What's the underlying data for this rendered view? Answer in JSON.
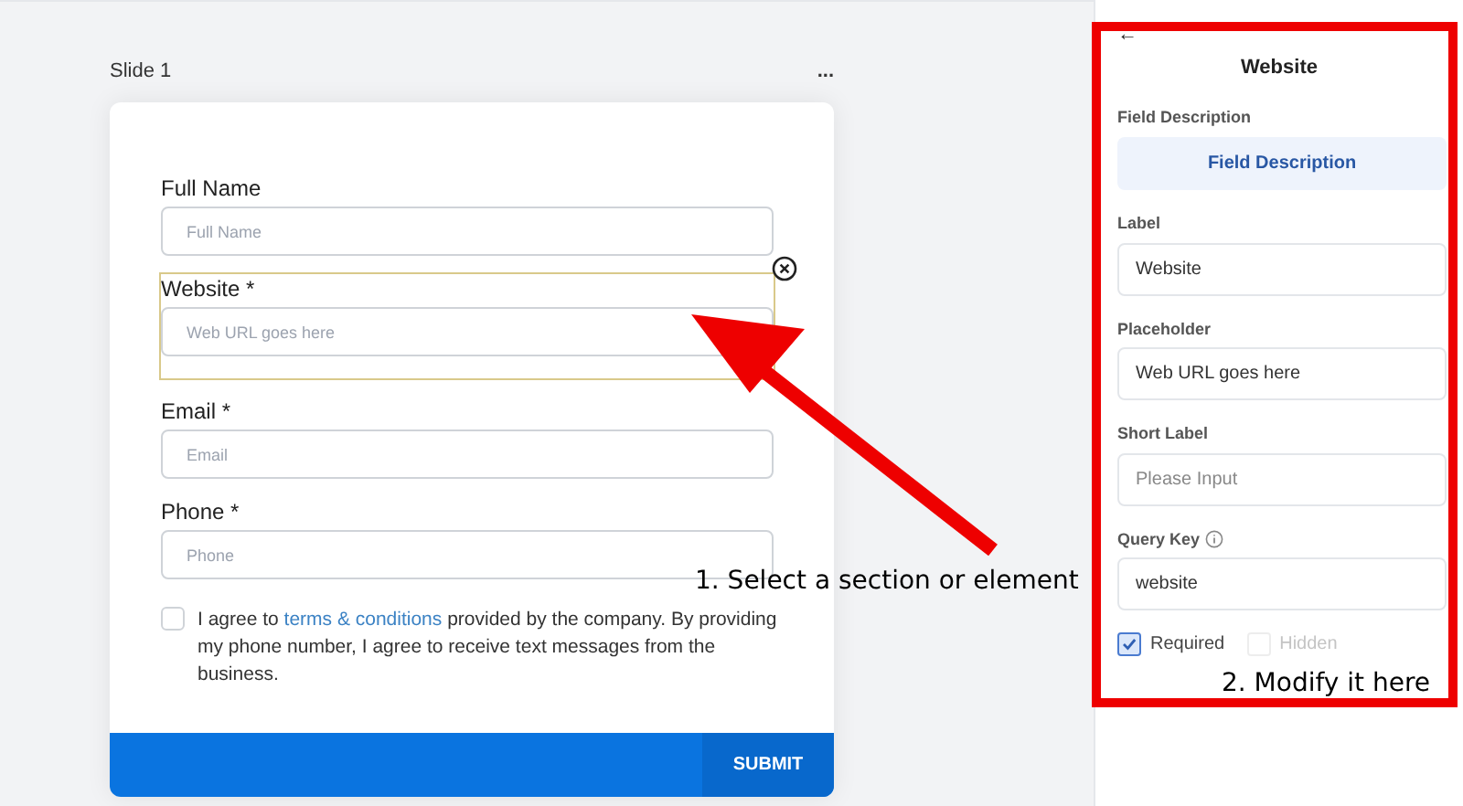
{
  "slide": {
    "title": "Slide 1",
    "menu": "..."
  },
  "form": {
    "fields": [
      {
        "label": "Full Name",
        "placeholder": "Full Name",
        "selected": false
      },
      {
        "label": "Website *",
        "placeholder": "Web URL goes here",
        "selected": true
      },
      {
        "label": "Email *",
        "placeholder": "Email",
        "selected": false
      },
      {
        "label": "Phone *",
        "placeholder": "Phone",
        "selected": false
      }
    ],
    "consent": {
      "checked": false,
      "before": "I agree to ",
      "link": "terms & conditions",
      "after": " provided by the company. By providing my phone number, I agree to receive text messages from the business."
    },
    "submit": "SUBMIT"
  },
  "panel": {
    "back": "←",
    "title": "Website",
    "description_label": "Field Description",
    "description_button": "Field Description",
    "inputs": [
      {
        "label": "Label",
        "value": "Website",
        "info": false
      },
      {
        "label": "Placeholder",
        "value": "Web URL goes here",
        "info": false
      },
      {
        "label": "Short Label",
        "placeholder": "Please Input",
        "info": false
      },
      {
        "label": "Query Key",
        "value": "website",
        "info": true
      }
    ],
    "options": [
      {
        "label": "Required",
        "checked": true,
        "disabled": false
      },
      {
        "label": "Hidden",
        "checked": false,
        "disabled": true
      }
    ]
  },
  "annotations": [
    "1. Select a section or element",
    "2. Modify it here"
  ]
}
